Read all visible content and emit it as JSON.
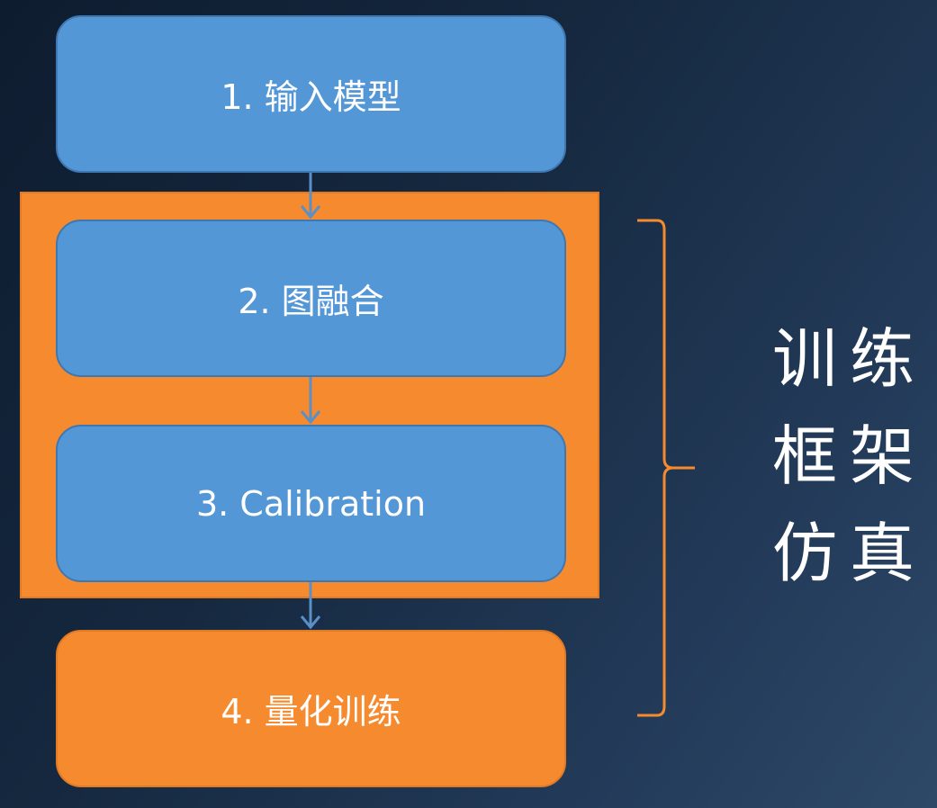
{
  "steps": [
    {
      "label": "1. 输入模型",
      "color": "blue"
    },
    {
      "label": "2. 图融合",
      "color": "blue"
    },
    {
      "label": "3. Calibration",
      "color": "blue"
    },
    {
      "label": "4. 量化训练",
      "color": "orange"
    }
  ],
  "side_label": {
    "line1": "训练",
    "line2": "框架",
    "line3": "仿真"
  },
  "colors": {
    "step_blue": "#5497d6",
    "group_orange": "#f68a2e",
    "arrow": "#5a8fc7",
    "bracket": "#f68a2e",
    "background": "#15283f"
  }
}
